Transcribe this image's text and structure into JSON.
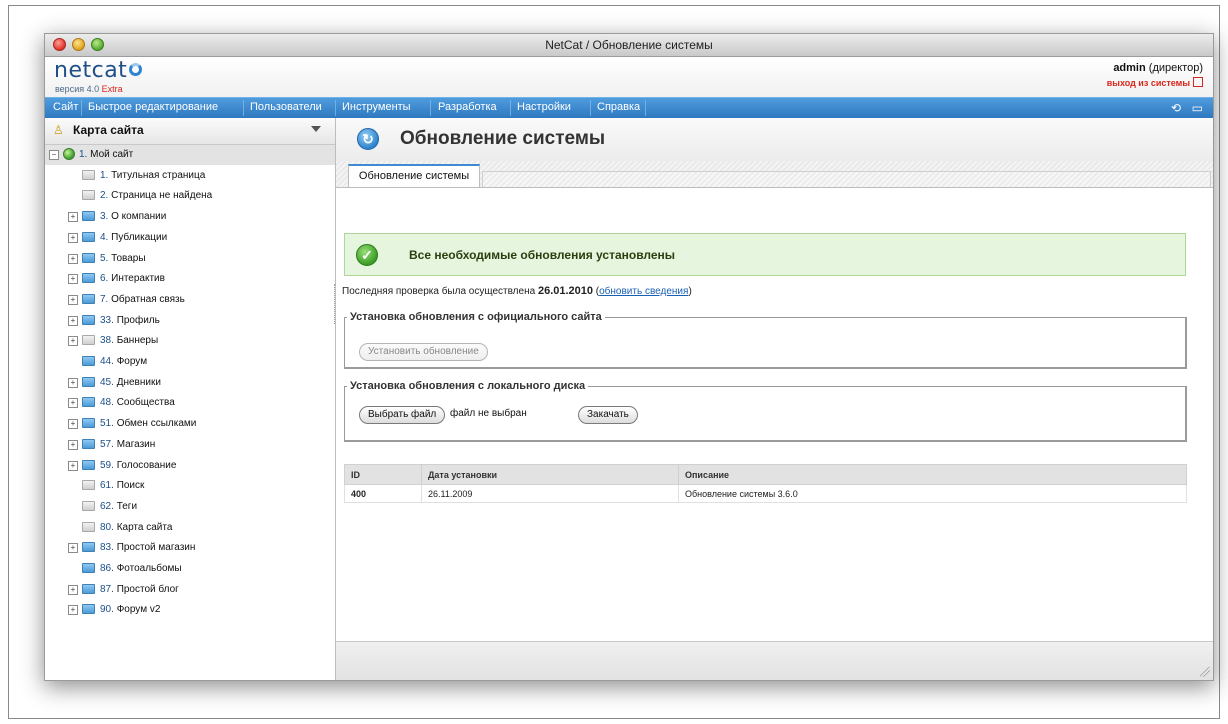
{
  "window": {
    "title": "NetCat / Обновление системы"
  },
  "header": {
    "logo": "netcat",
    "version_prefix": "версия 4.0",
    "version_extra": "Extra",
    "user_name": "admin",
    "user_role": "(директор)",
    "logout": "выход из системы"
  },
  "menu": {
    "items": [
      "Сайт",
      "Быстрое редактирование",
      "Пользователи",
      "Инструменты",
      "Разработка",
      "Настройки",
      "Справка"
    ],
    "right_icons": [
      "refresh-icon",
      "chat-icon"
    ]
  },
  "sidebar": {
    "title": "Карта сайта",
    "root": {
      "num": "1.",
      "label": "Мой сайт"
    },
    "items": [
      {
        "num": "1.",
        "label": "Титульная страница",
        "expandable": false,
        "folder": "grey"
      },
      {
        "num": "2.",
        "label": "Страница не найдена",
        "expandable": false,
        "folder": "grey"
      },
      {
        "num": "3.",
        "label": "О компании",
        "expandable": true,
        "folder": "blue"
      },
      {
        "num": "4.",
        "label": "Публикации",
        "expandable": true,
        "folder": "blue"
      },
      {
        "num": "5.",
        "label": "Товары",
        "expandable": true,
        "folder": "blue"
      },
      {
        "num": "6.",
        "label": "Интерактив",
        "expandable": true,
        "folder": "blue"
      },
      {
        "num": "7.",
        "label": "Обратная связь",
        "expandable": true,
        "folder": "blue"
      },
      {
        "num": "33.",
        "label": "Профиль",
        "expandable": true,
        "folder": "blue"
      },
      {
        "num": "38.",
        "label": "Баннеры",
        "expandable": true,
        "folder": "grey"
      },
      {
        "num": "44.",
        "label": "Форум",
        "expandable": false,
        "folder": "blue"
      },
      {
        "num": "45.",
        "label": "Дневники",
        "expandable": true,
        "folder": "blue"
      },
      {
        "num": "48.",
        "label": "Сообщества",
        "expandable": true,
        "folder": "blue"
      },
      {
        "num": "51.",
        "label": "Обмен ссылками",
        "expandable": true,
        "folder": "blue"
      },
      {
        "num": "57.",
        "label": "Магазин",
        "expandable": true,
        "folder": "blue"
      },
      {
        "num": "59.",
        "label": "Голосование",
        "expandable": true,
        "folder": "blue"
      },
      {
        "num": "61.",
        "label": "Поиск",
        "expandable": false,
        "folder": "grey"
      },
      {
        "num": "62.",
        "label": "Теги",
        "expandable": false,
        "folder": "grey"
      },
      {
        "num": "80.",
        "label": "Карта сайта",
        "expandable": false,
        "folder": "grey"
      },
      {
        "num": "83.",
        "label": "Простой магазин",
        "expandable": true,
        "folder": "blue"
      },
      {
        "num": "86.",
        "label": "Фотоальбомы",
        "expandable": false,
        "folder": "blue"
      },
      {
        "num": "87.",
        "label": "Простой блог",
        "expandable": true,
        "folder": "blue"
      },
      {
        "num": "90.",
        "label": "Форум v2",
        "expandable": true,
        "folder": "blue"
      }
    ]
  },
  "main": {
    "title": "Обновление системы",
    "tab": "Обновление системы",
    "success_message": "Все необходимые обновления установлены",
    "last_check_prefix": "Последняя проверка была осуществлена",
    "last_check_date": "26.01.2010",
    "refresh_link": "обновить сведения",
    "official": {
      "legend": "Установка обновления с официального сайта",
      "button": "Установить обновление"
    },
    "local": {
      "legend": "Установка обновления с локального диска",
      "choose_button": "Выбрать файл",
      "no_file": "файл не выбран",
      "upload_button": "Закачать"
    },
    "table": {
      "headers": [
        "ID",
        "Дата установки",
        "Описание"
      ],
      "rows": [
        [
          "400",
          "26.11.2009",
          "Обновление системы 3.6.0"
        ]
      ]
    }
  },
  "colors": {
    "menubar": "#3a86cc",
    "accent_red": "#d9261c",
    "success_bg": "#e6f5de"
  }
}
